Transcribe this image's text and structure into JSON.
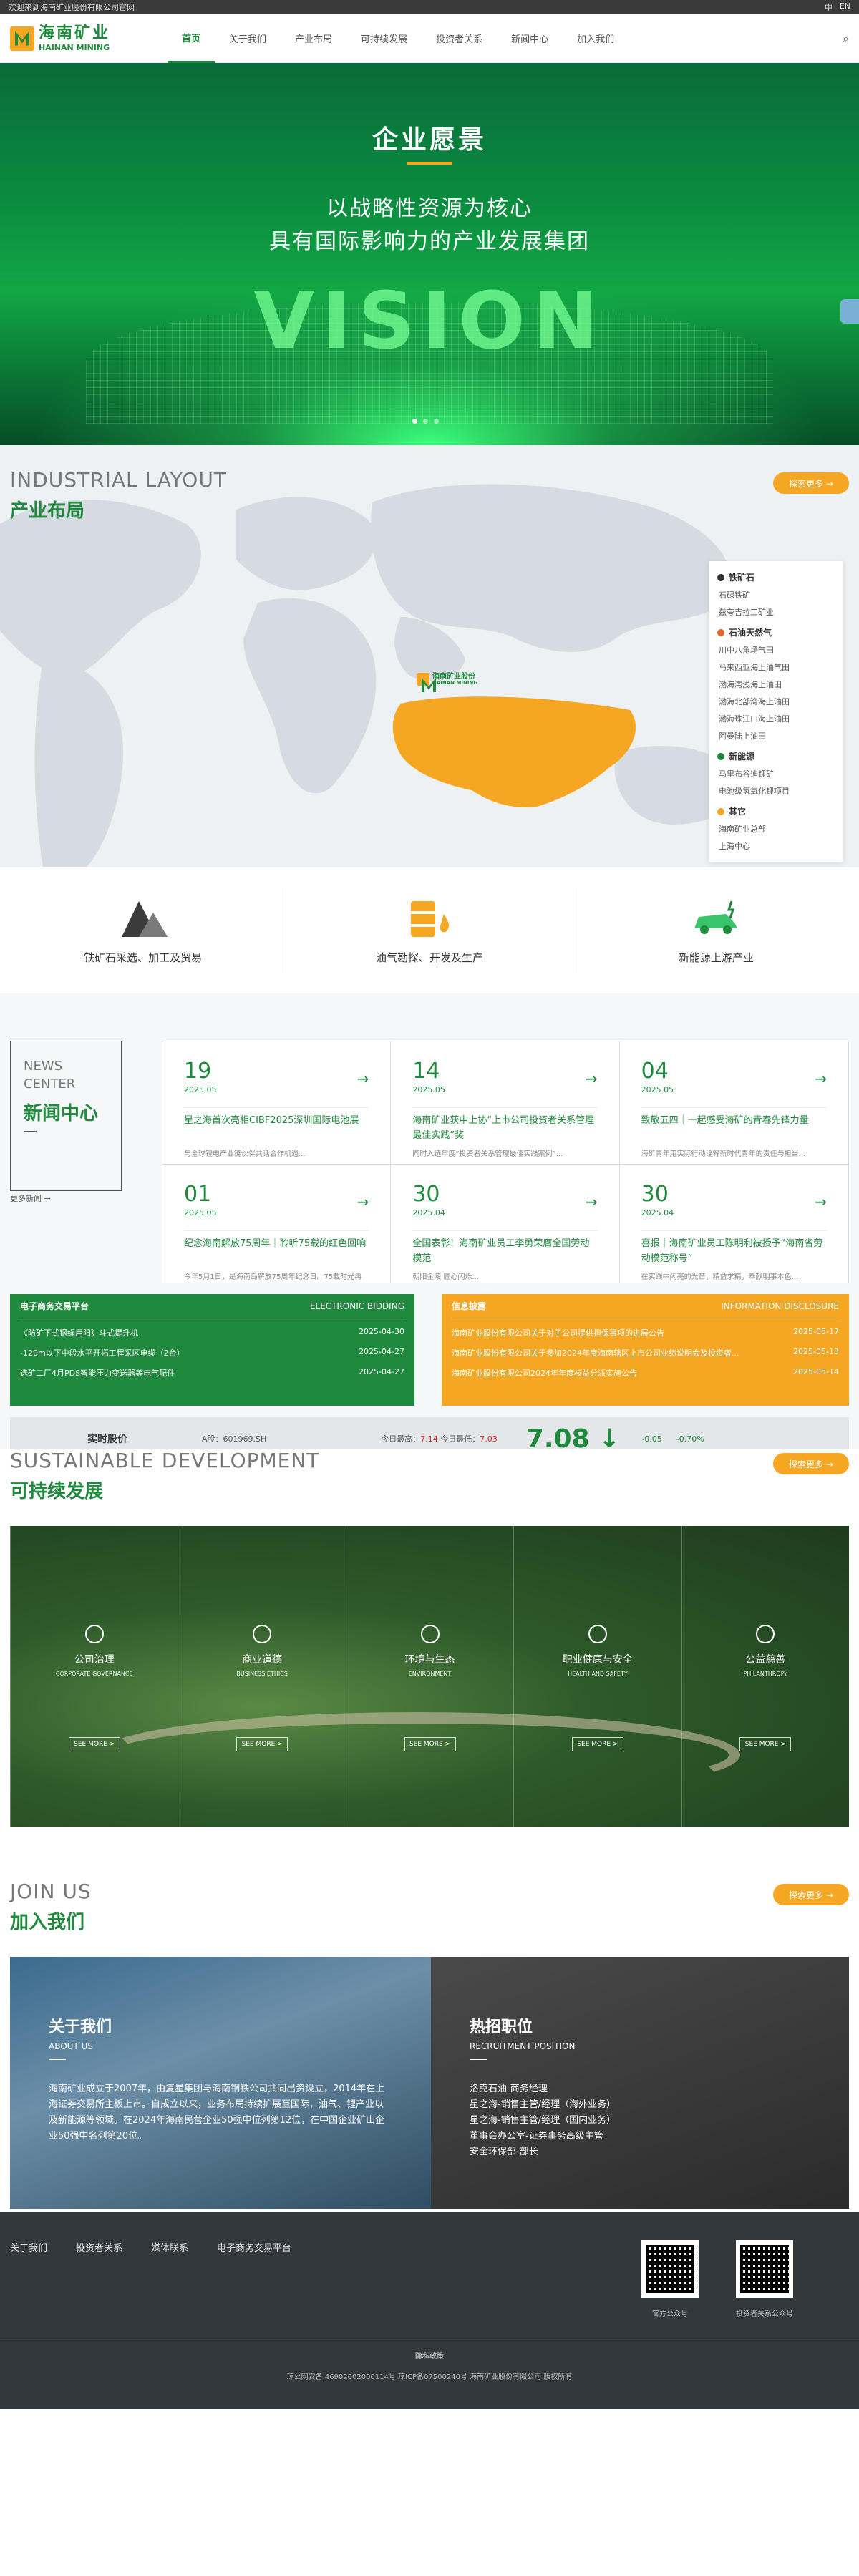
{
  "topbar": {
    "welcome": "欢迎来到海南矿业股份有限公司官网",
    "lang_en": "EN",
    "lang_zh": "中"
  },
  "header": {
    "logo_cn": "海南矿业",
    "logo_en": "HAINAN MINING",
    "nav": [
      "首页",
      "关于我们",
      "产业布局",
      "可持续发展",
      "投资者关系",
      "新闻中心",
      "加入我们"
    ]
  },
  "hero": {
    "title": "企业愿景",
    "line1": "以战略性资源为核心",
    "line2": "具有国际影响力的产业发展集团",
    "big_word": "VISION"
  },
  "layout": {
    "title_en": "INDUSTRIAL LAYOUT",
    "title_cn": "产业布局",
    "more": "探索更多 →",
    "map_logo_cn": "海南矿业股份",
    "map_logo_en": "HAINAN MINING",
    "legend": [
      {
        "name": "铁矿石",
        "color": "#333333",
        "items": [
          "石碌铁矿",
          "兹夸吉拉工矿业"
        ]
      },
      {
        "name": "石油天然气",
        "color": "#e8652a",
        "items": [
          "川中八角场气田",
          "马来西亚海上油气田",
          "渤海湾浅海上油田",
          "渤海北部湾海上油田",
          "渤海珠江口海上油田",
          "阿曼陆上油田"
        ]
      },
      {
        "name": "新能源",
        "color": "#1f8a3d",
        "items": [
          "马里布谷迪锂矿",
          "电池级氢氧化锂项目"
        ]
      },
      {
        "name": "其它",
        "color": "#f5a623",
        "items": [
          "海南矿业总部",
          "上海中心"
        ]
      }
    ],
    "biz": [
      "铁矿石采选、加工及贸易",
      "油气勘探、开发及生产",
      "新能源上游产业"
    ]
  },
  "news": {
    "title_en": "NEWS CENTER",
    "title_cn": "新闻中心",
    "more": "更多新闻 →",
    "items": [
      {
        "day": "19",
        "ym": "2025.05",
        "title": "星之海首次亮相CIBF2025深圳国际电池展",
        "desc": "与全球锂电产业链伙伴共话合作机遇..."
      },
      {
        "day": "14",
        "ym": "2025.05",
        "title": "海南矿业获中上协“上市公司投资者关系管理最佳实践”奖",
        "desc": "同时入选年度“投资者关系管理最佳实践案例”..."
      },
      {
        "day": "04",
        "ym": "2025.05",
        "title": "致敬五四｜一起感受海矿的青春先锋力量",
        "desc": "海矿青年用实际行动诠释新时代青年的责任与担当..."
      },
      {
        "day": "01",
        "ym": "2025.05",
        "title": "纪念海南解放75周年｜聆听75载的红色回响",
        "desc": "今年5月1日，是海南岛解放75周年纪念日。75载时光冉冉，石碌铁矿见证并参与了海南从战火..."
      },
      {
        "day": "30",
        "ym": "2025.04",
        "title": "全国表彰！海南矿业员工李勇荣膺全国劳动模范",
        "desc": "朝阳金陵 匠心闪烁..."
      },
      {
        "day": "30",
        "ym": "2025.04",
        "title": "喜报｜海南矿业员工陈明利被授予“海南省劳动模范称号”",
        "desc": "在实践中闪亮的光芒，精益求精，奉献明事本色..."
      }
    ]
  },
  "bidding": {
    "title": "电子商务交易平台",
    "title_en": "ELECTRONIC BIDDING",
    "rows": [
      {
        "t": "《防矿下式钢绳用阳》斗式提升机",
        "d": "2025-04-30"
      },
      {
        "t": "-120m以下中段水平开拓工程采区电缆（2台）",
        "d": "2025-04-27"
      },
      {
        "t": "选矿二厂4月PDS智能压力变送器等电气配件",
        "d": "2025-04-27"
      }
    ]
  },
  "info": {
    "title": "信息披露",
    "title_en": "INFORMATION DISCLOSURE",
    "rows": [
      {
        "t": "海南矿业股份有限公司关于对子公司提供担保事项的进展公告",
        "d": "2025-05-17"
      },
      {
        "t": "海南矿业股份有限公司关于参加2024年度海南辖区上市公司业绩说明会及投资者...",
        "d": "2025-05-13"
      },
      {
        "t": "海南矿业股份有限公司2024年年度权益分派实施公告",
        "d": "2025-05-14"
      }
    ]
  },
  "stock": {
    "label": "实时股价",
    "code": "A股：601969.SH",
    "high_label": "今日最高：",
    "high": "7.14",
    "low_label": "今日最低：",
    "low": "7.03",
    "price": "7.08",
    "change": "-0.05",
    "pct": "-0.70%"
  },
  "sustain": {
    "title_en": "SUSTAINABLE DEVELOPMENT",
    "title_cn": "可持续发展",
    "more": "探索更多 →",
    "cols": [
      {
        "cn": "公司治理",
        "en": "CORPORATE GOVERNANCE",
        "btn": "SEE MORE >"
      },
      {
        "cn": "商业道德",
        "en": "BUSINESS ETHICS",
        "btn": "SEE MORE >"
      },
      {
        "cn": "环境与生态",
        "en": "ENVIRONMENT",
        "btn": "SEE MORE >"
      },
      {
        "cn": "职业健康与安全",
        "en": "HEALTH AND SAFETY",
        "btn": "SEE MORE >"
      },
      {
        "cn": "公益慈善",
        "en": "PHILANTHROPY",
        "btn": "SEE MORE >"
      }
    ]
  },
  "join": {
    "title_en": "JOIN US",
    "title_cn": "加入我们",
    "more": "探索更多 →",
    "about_cn": "关于我们",
    "about_en": "ABOUT US",
    "about_text": "海南矿业成立于2007年，由复星集团与海南钢铁公司共同出资设立，2014年在上海证券交易所主板上市。自成立以来，业务布局持续扩展至国际，油气、锂产业以及新能源等领域。在2024年海南民营企业50强中位列第12位，在中国企业矿山企业50强中名列第20位。",
    "recruit_cn": "热招职位",
    "recruit_en": "RECRUITMENT POSITION",
    "jobs": [
      "洛克石油-商务经理",
      "星之海-销售主管/经理（海外业务）",
      "星之海-销售主管/经理（国内业务）",
      "董事会办公室-证券事务高级主管",
      "安全环保部-部长"
    ]
  },
  "footer": {
    "links": [
      "关于我们",
      "投资者关系",
      "媒体联系",
      "电子商务交易平台"
    ],
    "qr1": "官方公众号",
    "qr2": "投资者关系公众号",
    "bottom1": "隐私政策",
    "bottom2": "琼公网安备 46902602000114号  琼ICP备07500240号  海南矿业股份有限公司 版权所有"
  }
}
